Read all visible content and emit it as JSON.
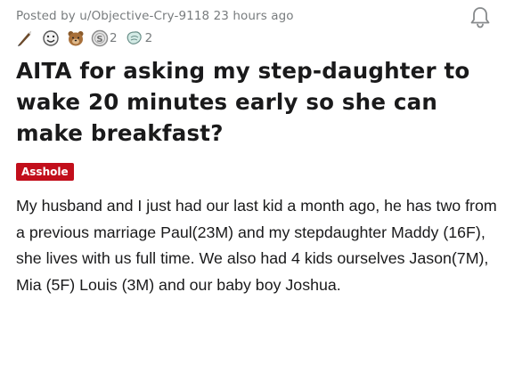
{
  "post": {
    "meta": "Posted by u/Objective-Cry-9118 23 hours ago",
    "awards": [
      {
        "icon": "pen-award-icon",
        "count": ""
      },
      {
        "icon": "smiley-award-icon",
        "count": ""
      },
      {
        "icon": "bear-award-icon",
        "count": ""
      },
      {
        "icon": "silver-award-icon",
        "count": "2"
      },
      {
        "icon": "helpful-award-icon",
        "count": "2"
      }
    ],
    "title": "AITA for asking my step-daughter to wake 20 minutes early so she can make breakfast?",
    "flair": "Asshole",
    "flair_color": "#c20e1b",
    "body": "My husband and I just had our last kid a month ago, he has two from a previous marriage Paul(23M) and my stepdaughter Maddy (16F), she lives with us full time. We also had 4 kids ourselves Jason(7M), Mia (5F) Louis (3M) and our baby boy Joshua."
  }
}
